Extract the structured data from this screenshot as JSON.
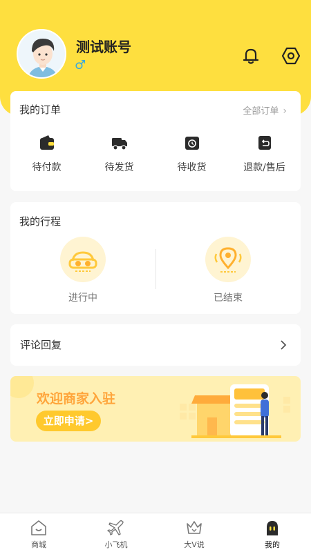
{
  "profile": {
    "name": "测试账号",
    "gender_symbol": "♂"
  },
  "orders": {
    "title": "我的订单",
    "all_label": "全部订单",
    "items": [
      {
        "label": "待付款",
        "icon": "wallet-icon"
      },
      {
        "label": "待发货",
        "icon": "truck-icon"
      },
      {
        "label": "待收货",
        "icon": "receive-icon"
      },
      {
        "label": "退款/售后",
        "icon": "refund-icon"
      }
    ]
  },
  "trips": {
    "title": "我的行程",
    "items": [
      {
        "label": "进行中",
        "icon": "car-icon"
      },
      {
        "label": "已结束",
        "icon": "location-pin-icon"
      }
    ]
  },
  "comments": {
    "label": "评论回复"
  },
  "banner": {
    "title": "欢迎商家入驻",
    "button": "立即申请>"
  },
  "tabbar": {
    "items": [
      {
        "label": "商城",
        "icon": "home-icon"
      },
      {
        "label": "小飞机",
        "icon": "airplane-icon"
      },
      {
        "label": "大V说",
        "icon": "crown-icon"
      },
      {
        "label": "我的",
        "icon": "profile-icon"
      }
    ],
    "active_index": 3
  },
  "colors": {
    "brand_yellow": "#fedf3f",
    "accent_orange": "#ffa53b",
    "gender_blue": "#35a8e0"
  }
}
